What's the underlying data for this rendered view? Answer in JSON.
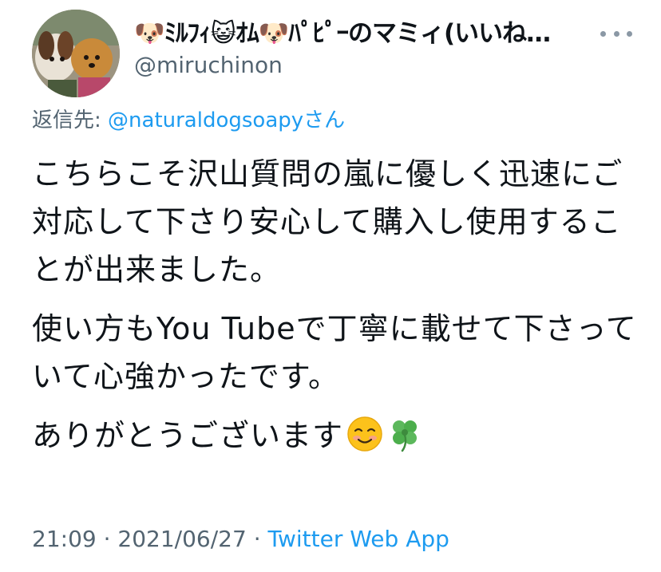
{
  "author": {
    "display_name": "🐶ﾐﾙﾌｨ😺ｵﾑ🐶ﾊﾟﾋﾟｰのマミィ(いいね…",
    "handle": "@miruchinon"
  },
  "reply": {
    "prefix": "返信先: ",
    "mention": "@naturaldogsoapy",
    "suffix": "さん"
  },
  "tweet": {
    "paragraph_1": "こちらこそ沢山質問の嵐に優しく迅速にご対応して下さり安心して購入し使用することが出来ました。",
    "paragraph_2": "使い方もYou Tubeで丁寧に載せて下さっていて心強かったです。",
    "paragraph_3": "ありがとうございます",
    "emojis": [
      "smiling-face-icon",
      "four-leaf-clover-icon"
    ]
  },
  "meta": {
    "time": "21:09",
    "separator": " · ",
    "date": "2021/06/27",
    "source": "Twitter Web App"
  },
  "colors": {
    "link": "#1d9bf0",
    "secondary_text": "#536471",
    "primary_text": "#0f1419"
  }
}
